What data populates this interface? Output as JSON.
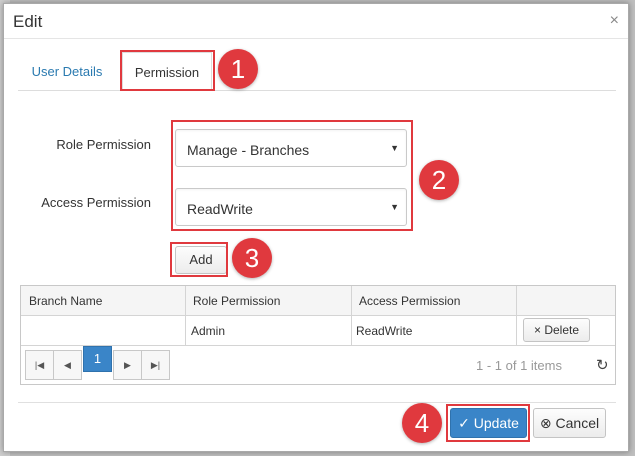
{
  "dialog": {
    "title": "Edit",
    "close_glyph": "×"
  },
  "tabs": [
    {
      "label": "User Details"
    },
    {
      "label": "Permission"
    }
  ],
  "form": {
    "role_label": "Role Permission",
    "role_value": "Manage - Branches",
    "access_label": "Access Permission",
    "access_value": "ReadWrite",
    "caret_glyph": "▼",
    "add_label": "Add"
  },
  "grid": {
    "columns": [
      "Branch Name",
      "Role Permission",
      "Access Permission"
    ],
    "rows": [
      {
        "branch": "",
        "role": "Admin",
        "access": "ReadWrite",
        "action": "Delete"
      }
    ],
    "delete_icon": "×",
    "pager": {
      "first": "|◀",
      "prev": "◀",
      "page": "1",
      "next": "▶",
      "last": "▶|",
      "info": "1 - 1 of 1 items",
      "refresh_glyph": "↻"
    }
  },
  "footer": {
    "update_label": "Update",
    "update_icon": "✓",
    "cancel_label": "Cancel",
    "cancel_icon": "⊗"
  },
  "callouts": [
    "1",
    "2",
    "3",
    "4"
  ],
  "colors": {
    "accent": "#3a85c8",
    "callout": "#e0393e",
    "link": "#2a7ab0"
  }
}
